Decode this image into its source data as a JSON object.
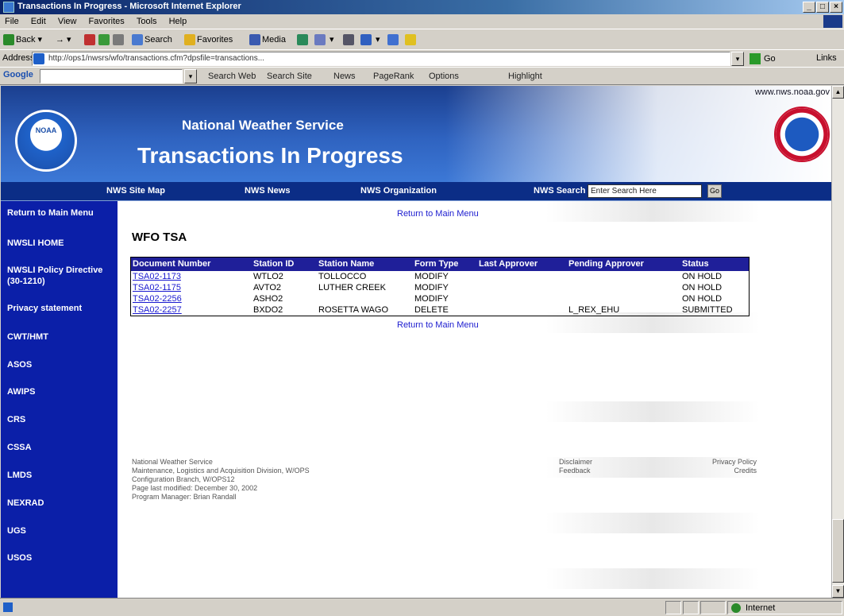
{
  "window": {
    "title": "Transactions In Progress - Microsoft Internet Explorer",
    "controls": [
      "_",
      "□",
      "×"
    ]
  },
  "menu": [
    "File",
    "Edit",
    "View",
    "Favorites",
    "Tools",
    "Help"
  ],
  "toolbar": {
    "back": "Back",
    "search": "Search",
    "favorites": "Favorites",
    "media": "Media"
  },
  "address": {
    "label": "Address",
    "url": "http://ops1/nwsrs/wfo/transactions.cfm?dpsfile=transactions...",
    "go": "Go",
    "links": "Links"
  },
  "google": {
    "logo": "Google",
    "search_web": "Search Web",
    "search_site": "Search Site",
    "news": "News",
    "pagerank": "PageRank",
    "options": "Options",
    "highlight": "Highlight"
  },
  "banner": {
    "org": "National Weather Service",
    "title": "Transactions In Progress",
    "url": "www.nws.noaa.gov",
    "noaa_label": "NOAA"
  },
  "nav": {
    "site_map": "NWS Site Map",
    "news": "NWS News",
    "organization": "NWS Organization",
    "search_label": "NWS Search",
    "search_value": "Enter Search Here",
    "go": "Go"
  },
  "sidebar": [
    "Return to Main Menu",
    "NWSLI HOME",
    "NWSLI Policy Directive (30-1210)",
    "Privacy statement",
    "CWT/HMT",
    "ASOS",
    "AWIPS",
    "CRS",
    "CSSA",
    "LMDS",
    "NEXRAD",
    "UGS",
    "USOS"
  ],
  "content": {
    "return_link": "Return to Main Menu",
    "office": "WFO TSA",
    "table": {
      "headers": [
        "Document Number",
        "Station ID",
        "Station Name",
        "Form Type",
        "Last Approver",
        "Pending Approver",
        "Status"
      ],
      "rows": [
        [
          "TSA02-1173",
          "WTLO2",
          "TOLLOCCO",
          "MODIFY",
          "",
          "",
          "ON HOLD"
        ],
        [
          "TSA02-1175",
          "AVTO2",
          "LUTHER CREEK",
          "MODIFY",
          "",
          "",
          "ON HOLD"
        ],
        [
          "TSA02-2256",
          "ASHO2",
          "",
          "MODIFY",
          "",
          "",
          "ON HOLD"
        ],
        [
          "TSA02-2257",
          "BXDO2",
          "ROSETTA WAGO",
          "DELETE",
          "",
          "L_REX_EHU",
          "SUBMITTED"
        ]
      ]
    },
    "footer_left": [
      "National Weather Service",
      "Maintenance, Logistics and Acquisition Division, W/OPS",
      "Configuration Branch, W/OPS12",
      "Page last modified: December 30, 2002",
      "Program Manager: Brian Randall"
    ],
    "footer_disclaimer": "Disclaimer",
    "footer_feedback": "Feedback",
    "footer_privacy": "Privacy Policy",
    "footer_credits": "Credits"
  },
  "status": {
    "zone": "Internet"
  }
}
